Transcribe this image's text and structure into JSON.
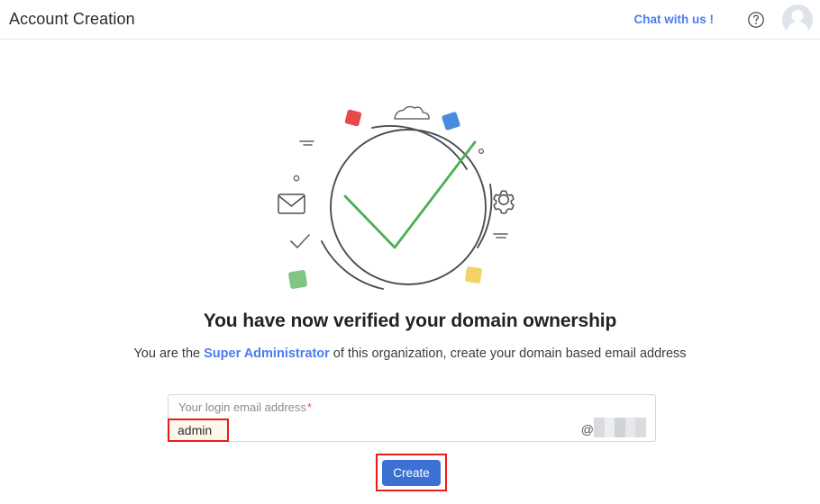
{
  "header": {
    "title": "Account Creation",
    "chat_label": "Chat with us !",
    "help_icon": "question-circle-icon",
    "avatar_icon": "user-avatar-icon"
  },
  "illustration": {
    "name": "domain-verified-illustration",
    "check_color": "#4caf50",
    "circle_color": "#4a4d52",
    "squares": [
      {
        "name": "red-square",
        "color": "#e8494a"
      },
      {
        "name": "blue-square",
        "color": "#4a8ade"
      },
      {
        "name": "green-square",
        "color": "#80c683"
      },
      {
        "name": "yellow-square",
        "color": "#f2d264"
      }
    ],
    "icons": [
      "cloud-icon",
      "envelope-icon",
      "gear-icon",
      "small-check-icon",
      "small-circle-icon",
      "dash-lines-icon"
    ]
  },
  "main": {
    "headline": "You have now verified your domain ownership",
    "subline_before": "You are the ",
    "subline_role": "Super Administrator",
    "subline_after": " of this organization, create your domain based email address"
  },
  "form": {
    "field_label": "Your login email address",
    "required_marker": "*",
    "email_local_value": "admin",
    "email_local_placeholder": "admin",
    "at_symbol": "@",
    "domain_value": "",
    "domain_redacted": true,
    "create_label": "Create"
  },
  "colors": {
    "accent_blue": "#3d70d3",
    "link_blue": "#4c7cf3",
    "annotation_red": "#ee1b16",
    "highlight_bg": "#fdf8ec",
    "required_red": "#ef4d3a"
  }
}
